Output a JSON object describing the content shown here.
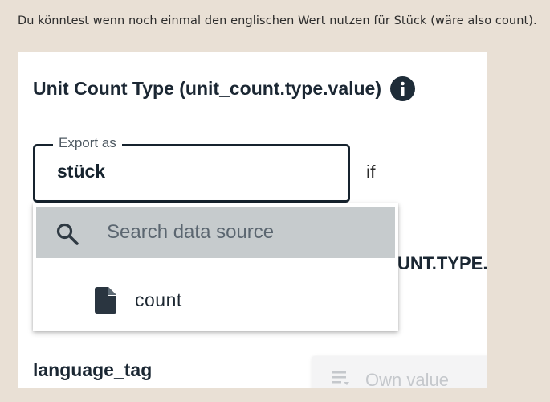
{
  "comment": {
    "text": "Du könntest wenn noch einmal den englischen Wert nutzen für Stück (wäre also count)."
  },
  "section": {
    "title": "Unit Count Type (unit_count.type.value)",
    "info_icon": "info-icon"
  },
  "export_field": {
    "legend": "Export as",
    "value": "stück"
  },
  "condition": {
    "if_label": "if",
    "truncated_value": "UNT.TYPE."
  },
  "dropdown": {
    "search_placeholder": "Search data source",
    "search_icon": "search-icon",
    "options": [
      {
        "label": "count",
        "icon": "file-icon"
      }
    ]
  },
  "language_tag": {
    "title": "language_tag",
    "own_value_label": "Own value",
    "own_value_icon": "lines-icon"
  },
  "colors": {
    "background": "#e9e0d5",
    "dark_accent": "#16232e",
    "search_bar": "#c6cbcd"
  }
}
